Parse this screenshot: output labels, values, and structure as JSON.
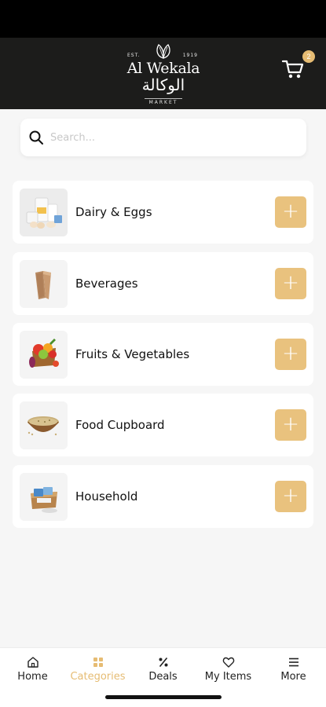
{
  "header": {
    "logo": {
      "est": "EST.",
      "year": "1919",
      "name_en": "Al Wekala",
      "name_ar": "الوكالة",
      "tagline": "MARKET"
    },
    "cart_count": "2"
  },
  "search": {
    "placeholder": "Search..."
  },
  "categories": [
    {
      "label": "Dairy & Eggs",
      "thumb": "dairy-eggs-icon"
    },
    {
      "label": "Beverages",
      "thumb": "beverages-icon"
    },
    {
      "label": "Fruits & Vegetables",
      "thumb": "fruits-vegetables-icon"
    },
    {
      "label": "Food Cupboard",
      "thumb": "food-cupboard-icon"
    },
    {
      "label": "Household",
      "thumb": "household-icon"
    }
  ],
  "add_symbol": "+",
  "tabs": [
    {
      "label": "Home",
      "icon": "home-icon",
      "active": false
    },
    {
      "label": "Categories",
      "icon": "grid-icon",
      "active": true
    },
    {
      "label": "Deals",
      "icon": "percent-icon",
      "active": false
    },
    {
      "label": "My Items",
      "icon": "heart-icon",
      "active": false
    },
    {
      "label": "More",
      "icon": "menu-icon",
      "active": false
    }
  ],
  "colors": {
    "accent": "#e9c27e",
    "header_bg": "#1c1c1b",
    "page_bg": "#f6f6f6"
  }
}
